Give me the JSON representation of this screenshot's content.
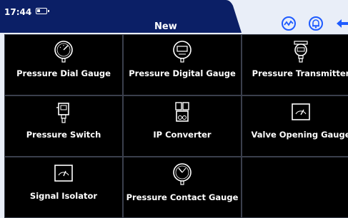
{
  "status": {
    "time": "17:44"
  },
  "header": {
    "title": "New"
  },
  "colors": {
    "bar": "#0b1f66",
    "accent": "#1e5bff",
    "background": "#e9eef8",
    "tile": "#000000"
  },
  "header_icons": [
    "chart-circle-icon",
    "bell-icon",
    "back-arrow-icon"
  ],
  "tiles": [
    {
      "label": "Pressure Dial Gauge",
      "icon": "dial-gauge-icon"
    },
    {
      "label": "Pressure Digital Gauge",
      "icon": "digital-gauge-icon"
    },
    {
      "label": "Pressure Transmitter",
      "icon": "transmitter-icon"
    },
    {
      "label": "Pressure Switch",
      "icon": "pressure-switch-icon"
    },
    {
      "label": "IP Converter",
      "icon": "ip-converter-icon"
    },
    {
      "label": "Valve Opening Gauge",
      "icon": "valve-opening-gauge-icon"
    },
    {
      "label": "Signal Isolator",
      "icon": "signal-isolator-icon"
    },
    {
      "label": "Pressure Contact Gauge",
      "icon": "contact-gauge-icon"
    }
  ]
}
